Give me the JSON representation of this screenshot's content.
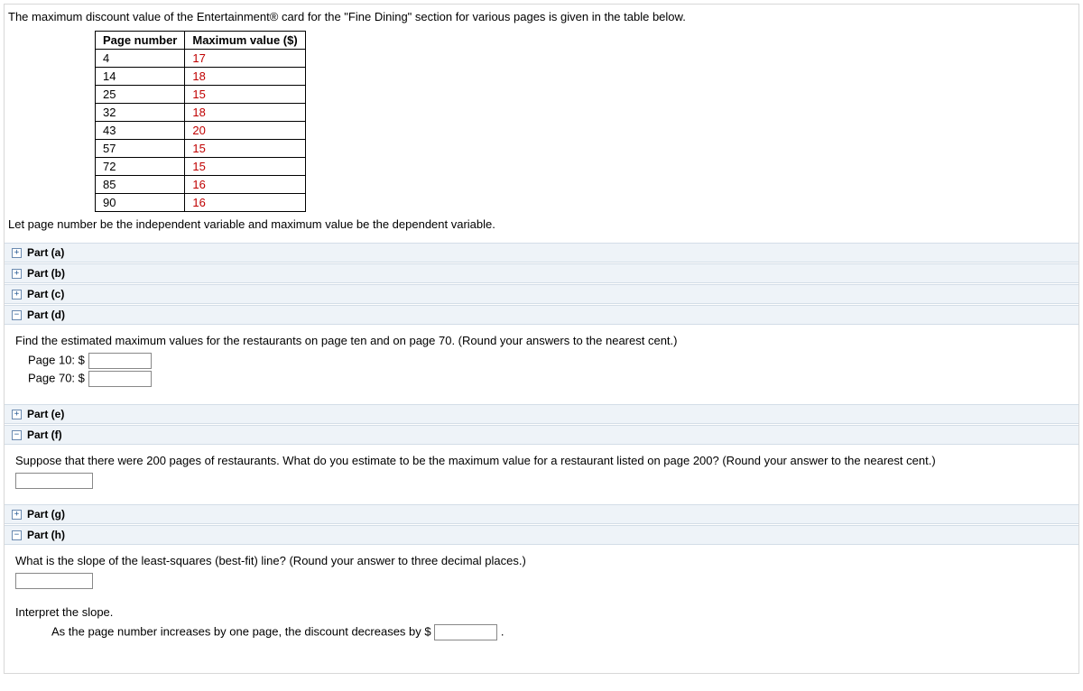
{
  "intro_text": "The maximum discount value of the Entertainment® card for the \"Fine Dining\" section for various pages is given in the table below.",
  "table": {
    "headers": [
      "Page number",
      "Maximum value ($)"
    ],
    "rows": [
      [
        "4",
        "17"
      ],
      [
        "14",
        "18"
      ],
      [
        "25",
        "15"
      ],
      [
        "32",
        "18"
      ],
      [
        "43",
        "20"
      ],
      [
        "57",
        "15"
      ],
      [
        "72",
        "15"
      ],
      [
        "85",
        "16"
      ],
      [
        "90",
        "16"
      ]
    ]
  },
  "below_text": "Let page number be the independent variable and maximum value be the dependent variable.",
  "parts": {
    "a": {
      "label": "Part (a)",
      "state": "+"
    },
    "b": {
      "label": "Part (b)",
      "state": "+"
    },
    "c": {
      "label": "Part (c)",
      "state": "+"
    },
    "d": {
      "label": "Part (d)",
      "state": "−",
      "question": "Find the estimated maximum values for the restaurants on page ten and on page 70. (Round your answers to the nearest cent.)",
      "field1_label": "Page 10: $",
      "field2_label": "Page 70: $"
    },
    "e": {
      "label": "Part (e)",
      "state": "+"
    },
    "f": {
      "label": "Part (f)",
      "state": "−",
      "question": "Suppose that there were 200 pages of restaurants. What do you estimate to be the maximum value for a restaurant listed on page 200? (Round your answer to the nearest cent.)"
    },
    "g": {
      "label": "Part (g)",
      "state": "+"
    },
    "h": {
      "label": "Part (h)",
      "state": "−",
      "question": "What is the slope of the least-squares (best-fit) line? (Round your answer to three decimal places.)",
      "interpret_label": "Interpret the slope.",
      "interpret_sentence_before": "As the page number increases by one page, the discount decreases by $",
      "interpret_sentence_after": "."
    }
  }
}
